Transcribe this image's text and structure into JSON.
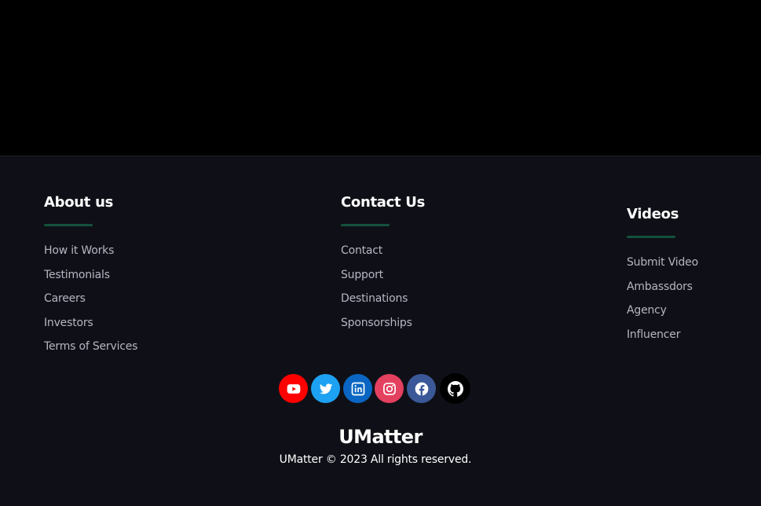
{
  "colors": {
    "page_bg": "#000000",
    "footer_bg": "#0f1017",
    "heading": "#ffffff",
    "link": "#b4b6c2",
    "accent_underline": "#14513c",
    "youtube": "#ff0000",
    "twitter": "#1da1f2",
    "linkedin": "#0a66c2",
    "instagram": "#e4405f",
    "facebook": "#3b5998",
    "github": "#000000"
  },
  "footer": {
    "about": {
      "heading": "About us",
      "links": [
        "How it Works",
        "Testimonials",
        "Careers",
        "Investors",
        "Terms of Services"
      ]
    },
    "contact": {
      "heading": "Contact Us",
      "links": [
        "Contact",
        "Support",
        "Destinations",
        "Sponsorships"
      ]
    },
    "videos": {
      "heading": "Videos",
      "links": [
        "Submit Video",
        "Ambassdors",
        "Agency",
        "Influencer"
      ]
    },
    "socials": [
      {
        "name": "youtube",
        "icon": "youtube-icon"
      },
      {
        "name": "twitter",
        "icon": "twitter-icon"
      },
      {
        "name": "linkedin",
        "icon": "linkedin-icon"
      },
      {
        "name": "instagram",
        "icon": "instagram-icon"
      },
      {
        "name": "facebook",
        "icon": "facebook-icon"
      },
      {
        "name": "github",
        "icon": "github-icon"
      }
    ],
    "brand": "UMatter",
    "copyright": "UMatter © 2023 All rights reserved."
  }
}
